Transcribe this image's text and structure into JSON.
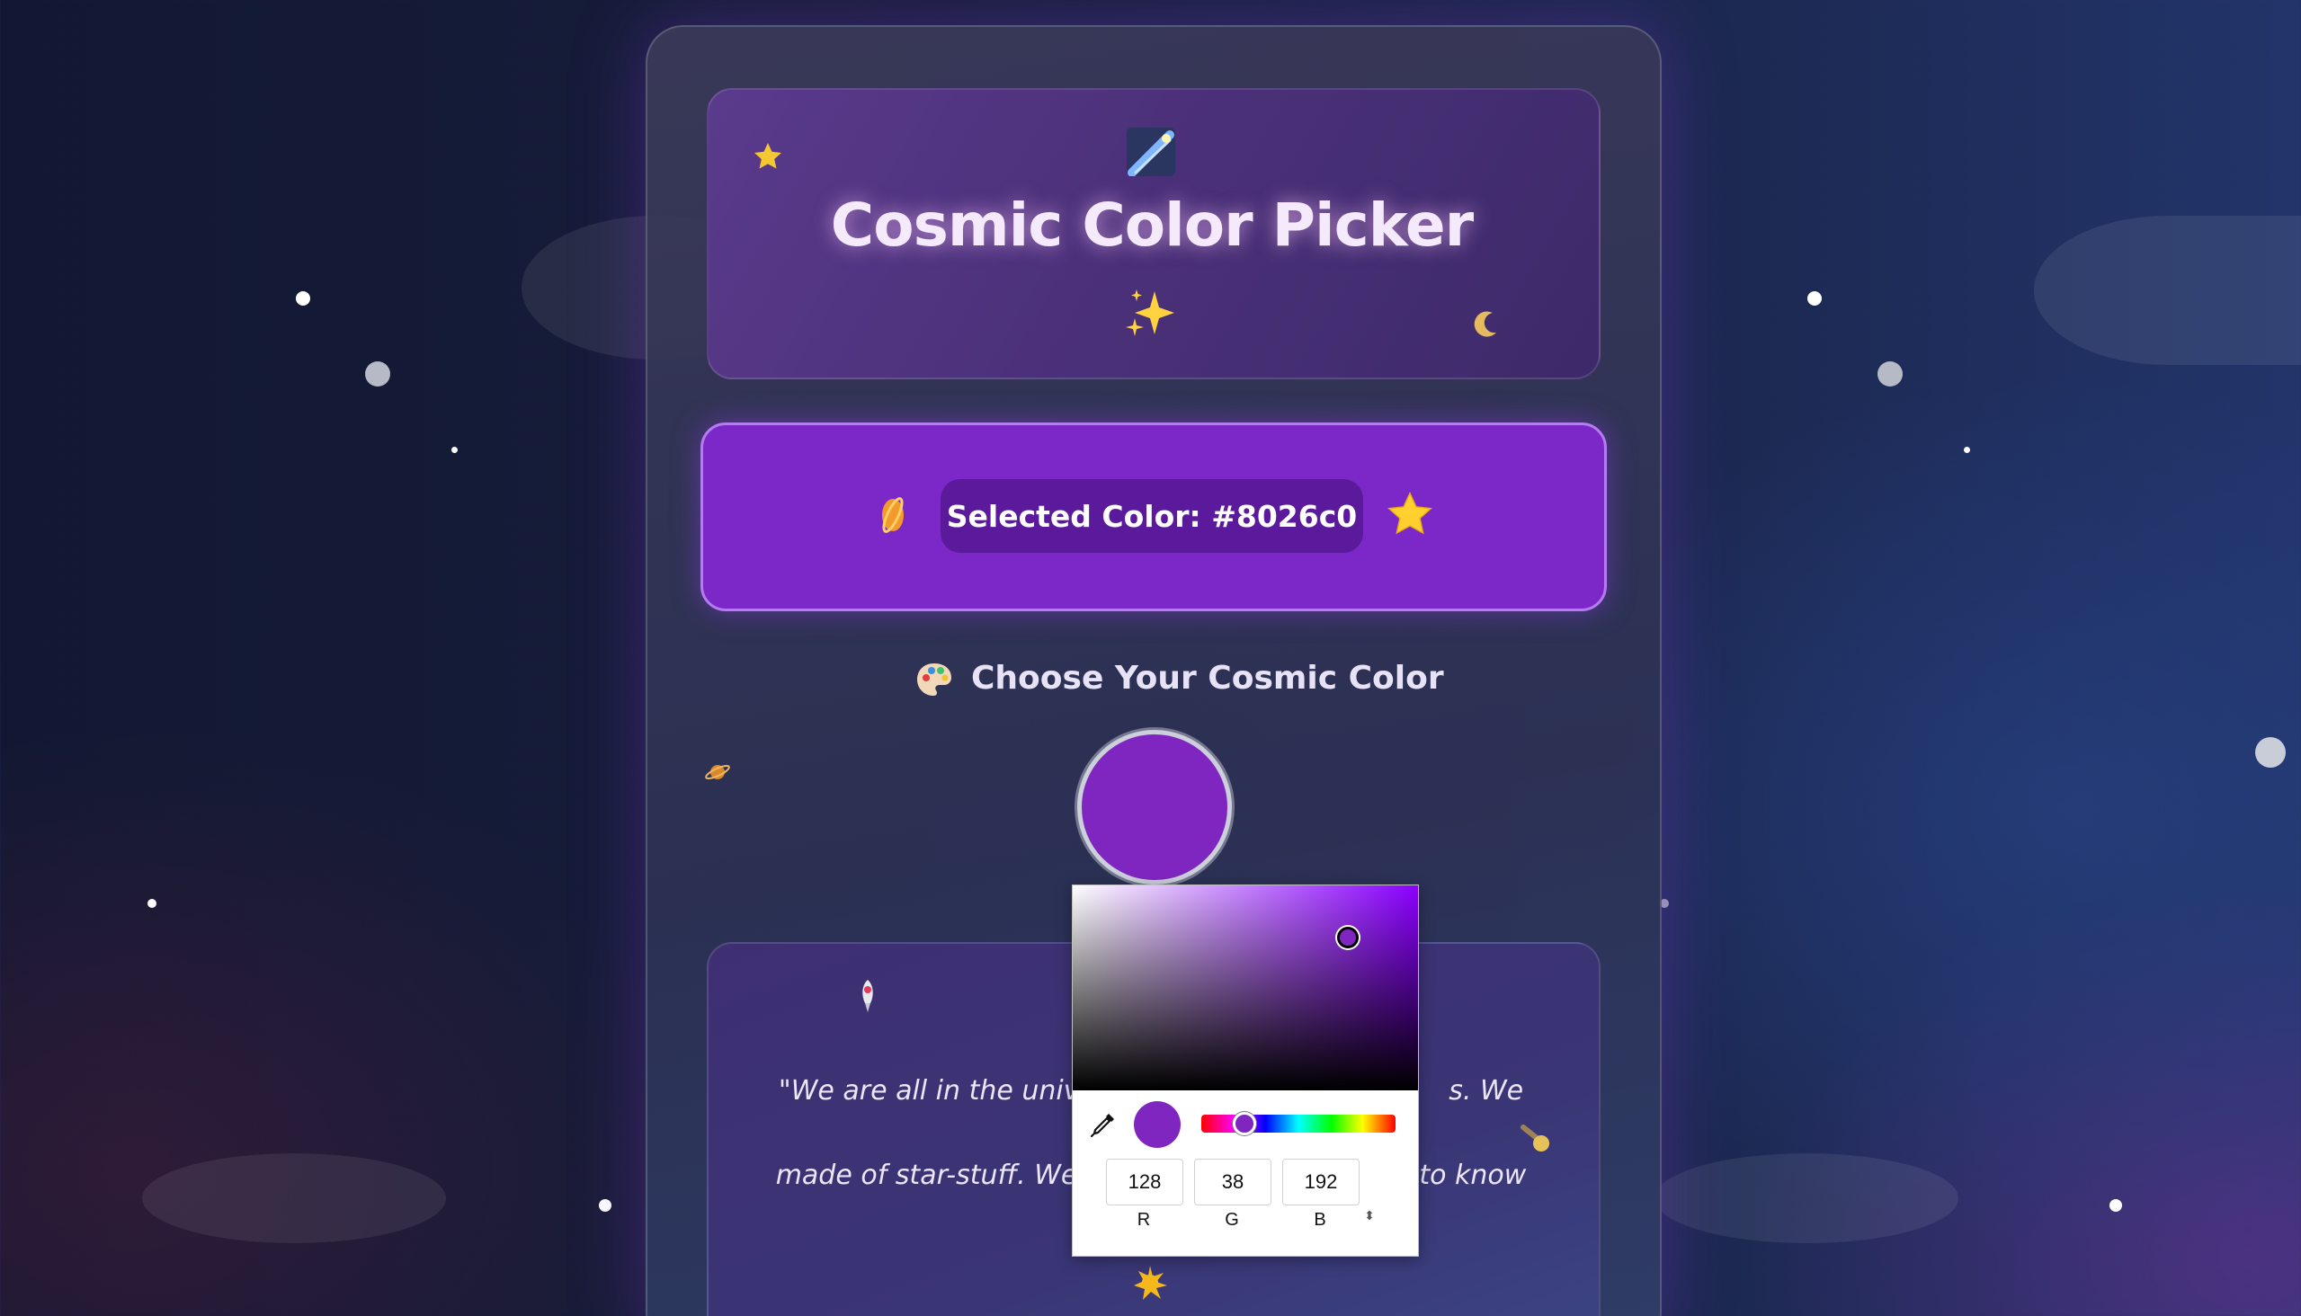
{
  "app": {
    "title": "Cosmic Color Picker"
  },
  "header": {
    "title": "Cosmic Color Picker",
    "icons": [
      "shooting-star",
      "sparkles",
      "star",
      "crescent-moon"
    ]
  },
  "selected": {
    "text": "Selected Color: #8026c0",
    "color": "#8026c0"
  },
  "choose": {
    "label": "Choose Your Cosmic Color"
  },
  "quote": {
    "line1_left": "\"We are all in the univer",
    "line1_right": "s. We are",
    "line2_left": "made of star-stuff. We",
    "line2_right": "to know"
  },
  "picker": {
    "r": "128",
    "g": "38",
    "b": "192",
    "r_label": "R",
    "g_label": "G",
    "b_label": "B",
    "mode_toggle": "⬍"
  },
  "colors": {
    "accent": "#8026c0",
    "selected_bg": "#7c28c8",
    "pill_bg": "#5b1a9c"
  }
}
